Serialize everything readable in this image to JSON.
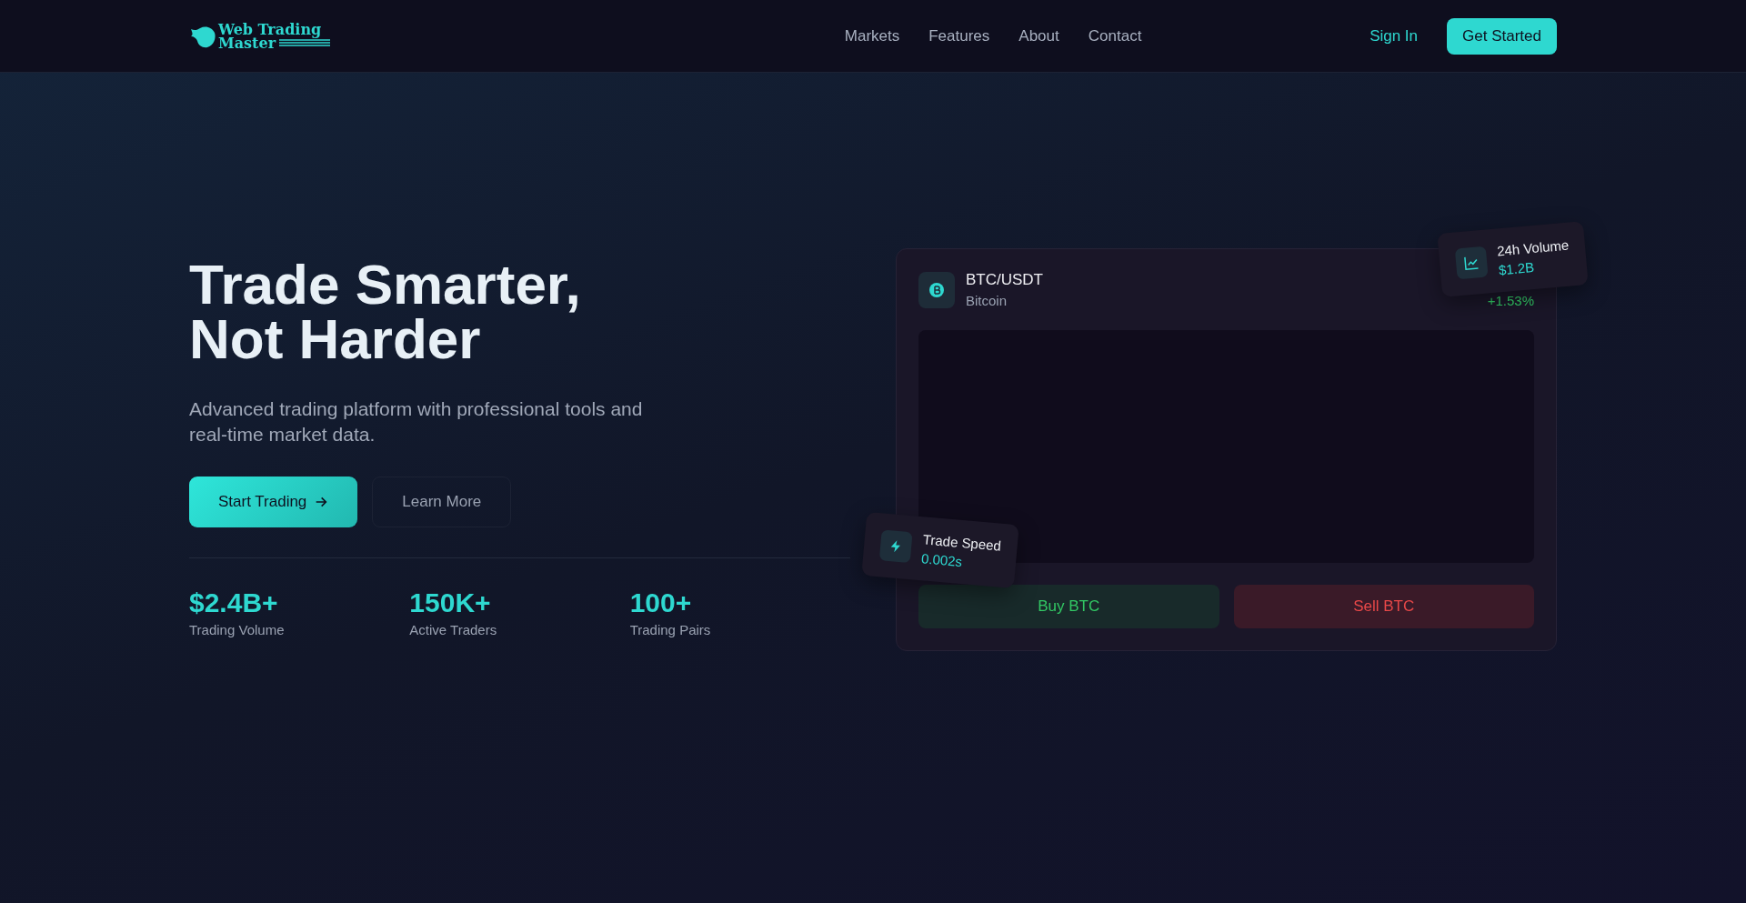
{
  "nav": {
    "logo": {
      "line1": "Web Trading",
      "line2": "Master"
    },
    "links": [
      "Markets",
      "Features",
      "About",
      "Contact"
    ],
    "sign_in": "Sign In",
    "cta": "Get Started"
  },
  "hero": {
    "title_line1": "Trade Smarter,",
    "title_line2": "Not Harder",
    "subtitle": "Advanced trading platform with professional tools and real-time market data.",
    "primary": "Start Trading",
    "secondary": "Learn More",
    "stats": [
      {
        "value": "$2.4B+",
        "label": "Trading Volume"
      },
      {
        "value": "150K+",
        "label": "Active Traders"
      },
      {
        "value": "100+",
        "label": "Trading Pairs"
      }
    ]
  },
  "panel": {
    "pair": "BTC/USDT",
    "name": "Bitcoin",
    "change": "+1.53%",
    "buy": "Buy BTC",
    "sell": "Sell BTC"
  },
  "floats": [
    {
      "kind": "volume",
      "label": "24h Volume",
      "value": "$1.2B"
    },
    {
      "kind": "speed",
      "label": "Trade Speed",
      "value": "0.002s"
    }
  ]
}
